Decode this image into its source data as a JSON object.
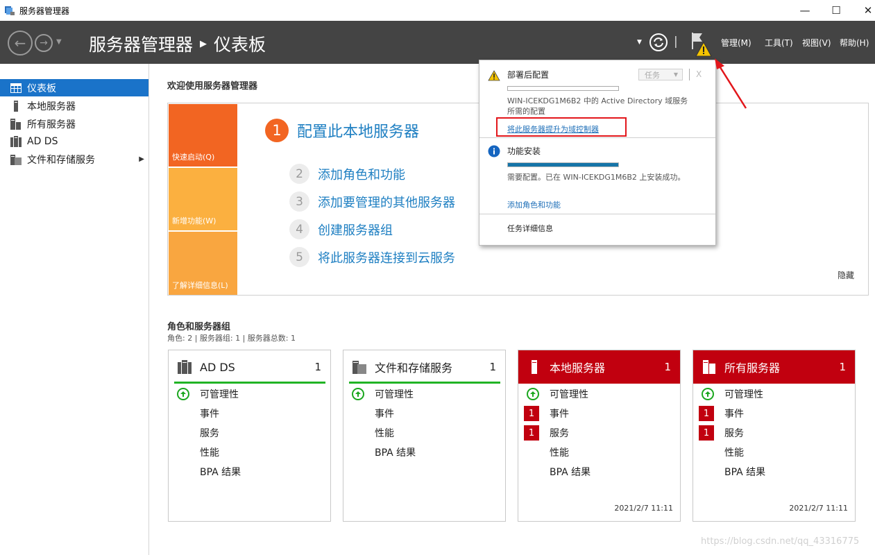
{
  "window": {
    "title": "服务器管理器",
    "minimize": "—",
    "maximize": "☐",
    "close": "✕"
  },
  "header": {
    "breadcrumb_app": "服务器管理器",
    "breadcrumb_sep": "▶",
    "breadcrumb_page": "仪表板",
    "menu_manage": "管理(M)",
    "menu_tools": "工具(T)",
    "menu_view": "视图(V)",
    "menu_help": "帮助(H)",
    "refresh_sep": "|"
  },
  "sidebar": {
    "items": [
      {
        "label": "仪表板",
        "icon": "dashboard-icon",
        "active": true
      },
      {
        "label": "本地服务器",
        "icon": "server-icon"
      },
      {
        "label": "所有服务器",
        "icon": "servers-icon"
      },
      {
        "label": "AD DS",
        "icon": "ad-ds-icon"
      },
      {
        "label": "文件和存储服务",
        "icon": "file-storage-icon",
        "expand": "▶"
      }
    ]
  },
  "welcome": {
    "title": "欢迎使用服务器管理器",
    "tiles": {
      "quick_start": "快速启动(Q)",
      "whats_new": "新增功能(W)",
      "learn_more": "了解详细信息(L)"
    },
    "steps": [
      {
        "num": "1",
        "label": "配置此本地服务器"
      },
      {
        "num": "2",
        "label": "添加角色和功能"
      },
      {
        "num": "3",
        "label": "添加要管理的其他服务器"
      },
      {
        "num": "4",
        "label": "创建服务器组"
      },
      {
        "num": "5",
        "label": "将此服务器连接到云服务"
      }
    ],
    "hide": "隐藏"
  },
  "roles": {
    "title": "角色和服务器组",
    "subtitle": "角色: 2 | 服务器组: 1 | 服务器总数: 1",
    "cards": [
      {
        "name": "AD DS",
        "count": "1",
        "rows": [
          "可管理性",
          "事件",
          "服务",
          "性能",
          "BPA 结果"
        ],
        "badges": [
          "",
          "",
          "",
          "",
          ""
        ],
        "time": ""
      },
      {
        "name": "文件和存储服务",
        "count": "1",
        "rows": [
          "可管理性",
          "事件",
          "性能",
          "BPA 结果"
        ],
        "badges": [
          "",
          "",
          "",
          ""
        ],
        "time": ""
      },
      {
        "name": "本地服务器",
        "count": "1",
        "rows": [
          "可管理性",
          "事件",
          "服务",
          "性能",
          "BPA 结果"
        ],
        "badges": [
          "",
          "1",
          "1",
          "",
          ""
        ],
        "time": "2021/2/7 11:11"
      },
      {
        "name": "所有服务器",
        "count": "1",
        "rows": [
          "可管理性",
          "事件",
          "服务",
          "性能",
          "BPA 结果"
        ],
        "badges": [
          "",
          "1",
          "1",
          "",
          ""
        ],
        "time": "2021/2/7 11:11"
      }
    ]
  },
  "notification": {
    "post_deploy_title": "部署后配置",
    "task_label": "任务",
    "close": "X",
    "post_deploy_text": "WIN-ICEKDG1M6B2 中的 Active Directory 域服务所需的配置",
    "post_deploy_text_1": "WIN-ICEKDG1M6B2 中的 Active Directory 域服务",
    "post_deploy_text_2": "所需的配置",
    "promote_link": "将此服务器提升为域控制器",
    "feature_title": "功能安装",
    "feature_text": "需要配置。已在 WIN-ICEKDG1M6B2 上安装成功。",
    "add_roles_link": "添加角色和功能",
    "task_details": "任务详细信息",
    "feature_progress": 1.0
  },
  "watermark": "https://blog.csdn.net/qq_43316775",
  "colors": {
    "header_bg": "#444444",
    "active_blue": "#1a73c9",
    "link_blue": "#1e7fc2",
    "alert_red": "#c1000f",
    "ok_green": "#21b425",
    "tile_orange": "#f26522",
    "tile_amber": "#fbb040",
    "progress_blue": "#1675a8"
  }
}
